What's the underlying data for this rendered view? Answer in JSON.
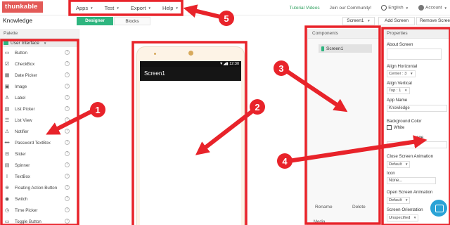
{
  "app": {
    "logo_text": "thunkable",
    "project_name": "Knowledge"
  },
  "top_menu": {
    "items": [
      {
        "label": "Apps"
      },
      {
        "label": "Test"
      },
      {
        "label": "Export"
      },
      {
        "label": "Help"
      }
    ]
  },
  "top_right": {
    "tutorial": "Tutorial Videos",
    "community": "Join our Community!",
    "language": "English",
    "account": "Account"
  },
  "toolbar": {
    "designer": "Designer",
    "blocks": "Blocks",
    "screen_select": "Screen1",
    "add_screen": "Add Screen",
    "remove_screen": "Remove Screen"
  },
  "palette": {
    "title": "Palette",
    "category": "User Interface",
    "items": [
      {
        "label": "Button",
        "icon": "▭"
      },
      {
        "label": "CheckBox",
        "icon": "☑"
      },
      {
        "label": "Date Picker",
        "icon": "▦"
      },
      {
        "label": "Image",
        "icon": "▣"
      },
      {
        "label": "Label",
        "icon": "A"
      },
      {
        "label": "List Picker",
        "icon": "▤"
      },
      {
        "label": "List View",
        "icon": "☰"
      },
      {
        "label": "Notifier",
        "icon": "⚠"
      },
      {
        "label": "Password TextBox",
        "icon": "•••"
      },
      {
        "label": "Slider",
        "icon": "⊟"
      },
      {
        "label": "Spinner",
        "icon": "▤"
      },
      {
        "label": "TextBox",
        "icon": "I"
      },
      {
        "label": "Floating Action Button",
        "icon": "⊕"
      },
      {
        "label": "Switch",
        "icon": "◉"
      },
      {
        "label": "Time Picker",
        "icon": "◷"
      },
      {
        "label": "Toggle Button",
        "icon": "▭"
      }
    ]
  },
  "phone": {
    "status_time": "12:30",
    "screen_title": "Screen1"
  },
  "components": {
    "title": "Components",
    "screen": "Screen1",
    "rename": "Rename",
    "delete": "Delete",
    "media": "Media"
  },
  "properties": {
    "title": "Properties",
    "about_screen": "About Screen",
    "align_horizontal": "Align Horizontal",
    "align_horizontal_value": "Center : 3",
    "align_vertical": "Align Vertical",
    "align_vertical_value": "Top : 1",
    "app_name": "App Name",
    "app_name_value": "Knowledge",
    "background_color": "Background Color",
    "background_color_value": "White",
    "background_image_partial": "age",
    "close_screen_animation": "Close Screen Animation",
    "close_screen_animation_value": "Default",
    "icon": "Icon",
    "icon_value": "None...",
    "open_screen_animation": "Open Screen Animation",
    "open_screen_animation_value": "Default",
    "screen_orientation": "Screen Orientation",
    "screen_orientation_value": "Unspecified"
  },
  "callouts": [
    "1",
    "2",
    "3",
    "4",
    "5"
  ],
  "colors": {
    "brand": "#e35a57",
    "accent": "#2eb57f",
    "annotation": "#e8232a"
  }
}
